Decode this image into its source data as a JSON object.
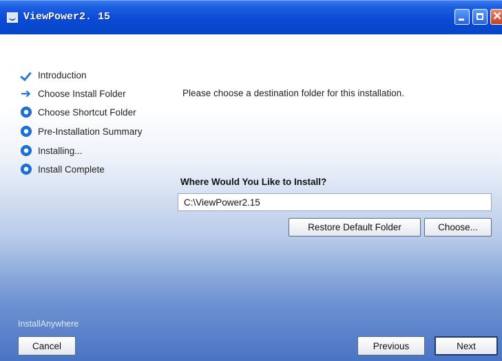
{
  "window": {
    "title": "ViewPower2. 15"
  },
  "steps": [
    {
      "label": "Introduction",
      "state": "done"
    },
    {
      "label": "Choose Install Folder",
      "state": "current"
    },
    {
      "label": "Choose Shortcut Folder",
      "state": "pending"
    },
    {
      "label": "Pre-Installation Summary",
      "state": "pending"
    },
    {
      "label": "Installing...",
      "state": "pending"
    },
    {
      "label": "Install Complete",
      "state": "pending"
    }
  ],
  "main": {
    "instruction": "Please choose a destination folder for this installation.",
    "where_label": "Where Would You Like to Install?",
    "install_path": "C:\\ViewPower2.15",
    "restore_button": "Restore Default Folder",
    "choose_button": "Choose..."
  },
  "footer": {
    "brand": "InstallAnywhere",
    "cancel_button": "Cancel",
    "previous_button": "Previous",
    "next_button": "Next"
  },
  "colors": {
    "titlebar": "#0a4ad6",
    "accent": "#1a72d8"
  },
  "icons": {
    "done": "checkmark-icon",
    "current": "arrow-right-icon",
    "pending": "radio-dot-icon"
  }
}
